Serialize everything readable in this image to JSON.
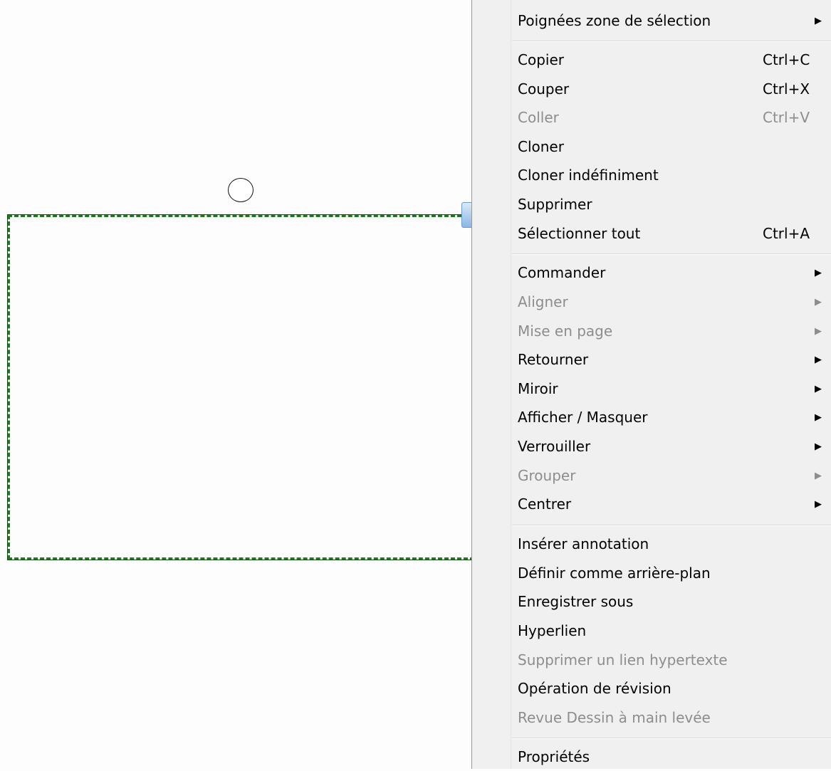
{
  "menu": {
    "items": [
      {
        "label": "Poignées zone de sélection",
        "shortcut": "",
        "submenu": true,
        "enabled": true
      },
      {
        "label": "Copier",
        "shortcut": "Ctrl+C",
        "submenu": false,
        "enabled": true
      },
      {
        "label": "Couper",
        "shortcut": "Ctrl+X",
        "submenu": false,
        "enabled": true
      },
      {
        "label": "Coller",
        "shortcut": "Ctrl+V",
        "submenu": false,
        "enabled": false
      },
      {
        "label": "Cloner",
        "shortcut": "",
        "submenu": false,
        "enabled": true
      },
      {
        "label": "Cloner indéfiniment",
        "shortcut": "",
        "submenu": false,
        "enabled": true
      },
      {
        "label": "Supprimer",
        "shortcut": "",
        "submenu": false,
        "enabled": true
      },
      {
        "label": "Sélectionner tout",
        "shortcut": "Ctrl+A",
        "submenu": false,
        "enabled": true
      },
      {
        "label": "Commander",
        "shortcut": "",
        "submenu": true,
        "enabled": true
      },
      {
        "label": "Aligner",
        "shortcut": "",
        "submenu": true,
        "enabled": false
      },
      {
        "label": "Mise en page",
        "shortcut": "",
        "submenu": true,
        "enabled": false
      },
      {
        "label": "Retourner",
        "shortcut": "",
        "submenu": true,
        "enabled": true
      },
      {
        "label": "Miroir",
        "shortcut": "",
        "submenu": true,
        "enabled": true
      },
      {
        "label": "Afficher / Masquer",
        "shortcut": "",
        "submenu": true,
        "enabled": true
      },
      {
        "label": "Verrouiller",
        "shortcut": "",
        "submenu": true,
        "enabled": true
      },
      {
        "label": "Grouper",
        "shortcut": "",
        "submenu": true,
        "enabled": false
      },
      {
        "label": "Centrer",
        "shortcut": "",
        "submenu": true,
        "enabled": true
      },
      {
        "label": "Insérer annotation",
        "shortcut": "",
        "submenu": false,
        "enabled": true
      },
      {
        "label": "Définir comme arrière-plan",
        "shortcut": "",
        "submenu": false,
        "enabled": true
      },
      {
        "label": "Enregistrer sous",
        "shortcut": "",
        "submenu": false,
        "enabled": true
      },
      {
        "label": "Hyperlien",
        "shortcut": "",
        "submenu": false,
        "enabled": true
      },
      {
        "label": "Supprimer un lien hypertexte",
        "shortcut": "",
        "submenu": false,
        "enabled": false
      },
      {
        "label": "Opération de révision",
        "shortcut": "",
        "submenu": false,
        "enabled": true
      },
      {
        "label": "Revue Dessin à main levée",
        "shortcut": "",
        "submenu": false,
        "enabled": false
      },
      {
        "label": "Propriétés",
        "shortcut": "",
        "submenu": false,
        "enabled": true
      }
    ],
    "submenu_arrow_icon": "triangle-right-icon"
  },
  "colors": {
    "menu_bg": "#f0f0f0",
    "disabled_text": "#8d8d8d",
    "selection_border": "#1d7a1d",
    "handle_accent": "#8ab6e6"
  }
}
